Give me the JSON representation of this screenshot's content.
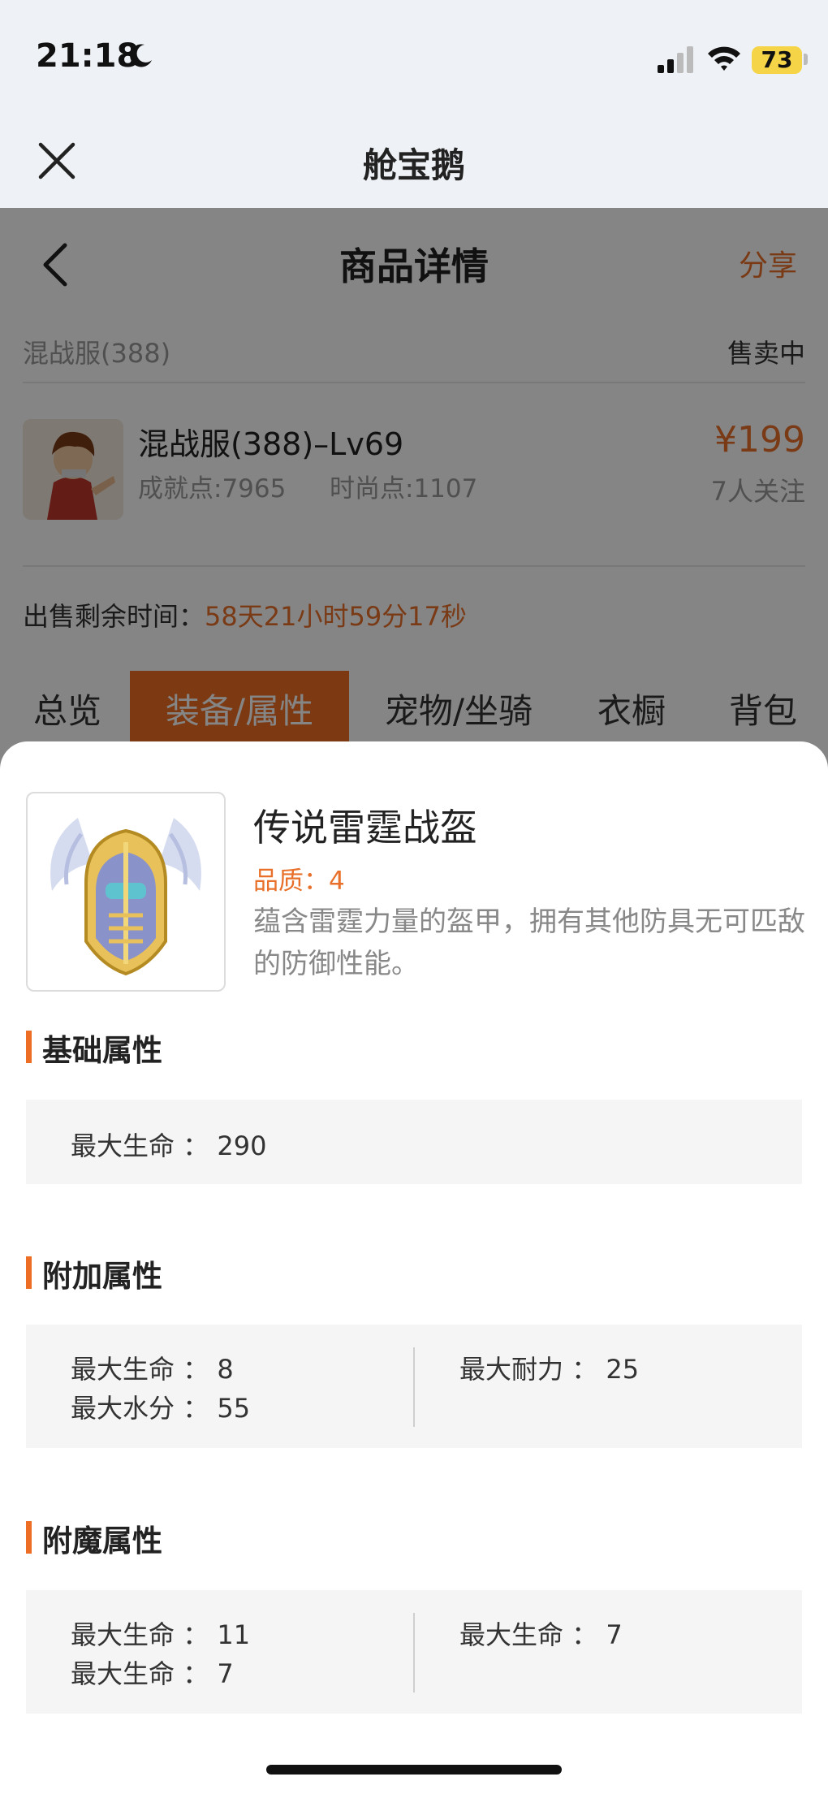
{
  "status_bar": {
    "time": "21:18",
    "battery": "73"
  },
  "app_bar": {
    "title": "舱宝鹅"
  },
  "page": {
    "title": "商品详情",
    "share": "分享",
    "server": "混战服(388)",
    "sale_status": "售卖中",
    "item": {
      "name": "混战服(388)–Lv69",
      "achievement": "成就点:7965",
      "fashion": "时尚点:1107",
      "price": "¥199",
      "followers": "7人关注"
    },
    "remaining_label": "出售剩余时间：",
    "remaining_value": "58天21小时59分17秒",
    "tabs": [
      "总览",
      "装备/属性",
      "宠物/坐骑",
      "衣橱",
      "背包"
    ],
    "active_tab": "装备/属性"
  },
  "sheet": {
    "name": "传说雷霆战盔",
    "quality": "品质：4",
    "description": "蕴含雷霆力量的盔甲，拥有其他防具无可匹敌的防御性能。",
    "basic": {
      "title": "基础属性",
      "attrs": [
        {
          "label": "最大生命",
          "value": "290"
        }
      ]
    },
    "extra": {
      "title": "附加属性",
      "left": [
        {
          "label": "最大生命",
          "value": "8"
        },
        {
          "label": "最大水分",
          "value": "55"
        }
      ],
      "right": [
        {
          "label": "最大耐力",
          "value": "25"
        }
      ]
    },
    "enchant": {
      "title": "附魔属性",
      "left": [
        {
          "label": "最大生命",
          "value": "11"
        },
        {
          "label": "最大生命",
          "value": "7"
        }
      ],
      "right": [
        {
          "label": "最大生命",
          "value": "7"
        }
      ]
    }
  },
  "colors": {
    "accent": "#ED6D24",
    "background": "#EEF1F5"
  },
  "icons": [
    "moon-icon",
    "signal-icon",
    "wifi-icon",
    "close-icon",
    "back-arrow-icon"
  ]
}
